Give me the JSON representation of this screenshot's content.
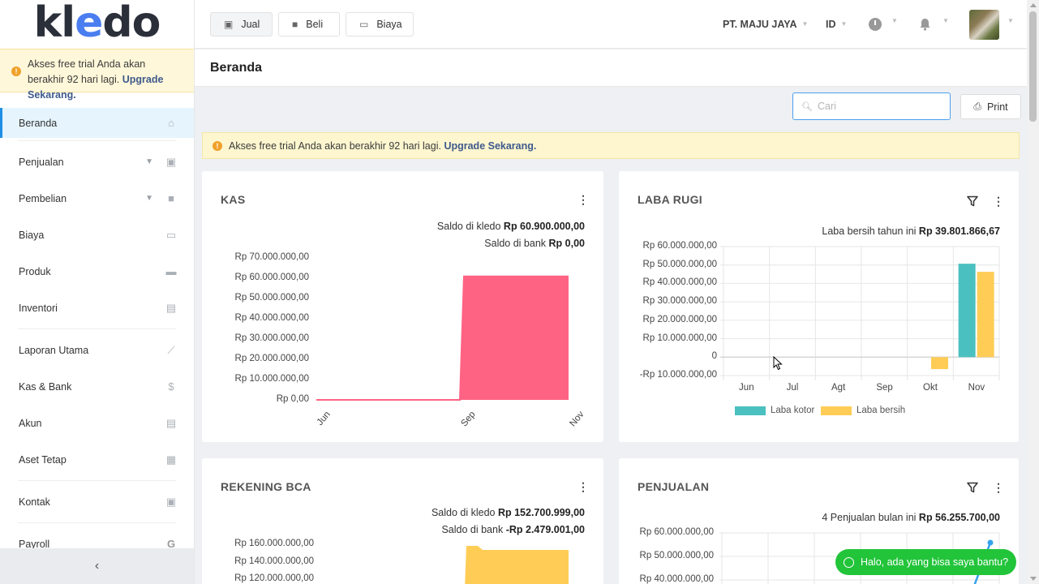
{
  "sidebar": {
    "logo": {
      "pre": "kl",
      "mark": "e",
      "post": "do"
    },
    "trial": {
      "text": "Akses free trial Anda akan berakhir 92 hari lagi.",
      "link": "Upgrade Sekarang."
    },
    "items": [
      {
        "label": "Beranda",
        "icon": "home-icon"
      },
      {
        "label": "Penjualan",
        "icon": "basket-icon"
      },
      {
        "label": "Pembelian",
        "icon": "bag-icon"
      },
      {
        "label": "Biaya",
        "icon": "card-icon"
      },
      {
        "label": "Produk",
        "icon": "box-icon"
      },
      {
        "label": "Inventori",
        "icon": "warehouse-icon"
      },
      {
        "label": "Laporan Utama",
        "icon": "chart-line-icon"
      },
      {
        "label": "Kas & Bank",
        "icon": "dollar-icon"
      },
      {
        "label": "Akun",
        "icon": "list-icon"
      },
      {
        "label": "Aset Tetap",
        "icon": "building-icon"
      },
      {
        "label": "Kontak",
        "icon": "contact-card-icon"
      },
      {
        "label": "Payroll",
        "icon": "payroll-icon"
      }
    ],
    "collapse": "‹"
  },
  "topbar": {
    "jual": "Jual",
    "beli": "Beli",
    "biaya": "Biaya",
    "company": "PT. MAJU JAYA",
    "lang": "ID"
  },
  "page": {
    "title": "Beranda"
  },
  "search": {
    "placeholder": "Cari"
  },
  "print_label": "Print",
  "alert": {
    "text": "Akses free trial Anda akan berakhir 92 hari lagi.",
    "link": "Upgrade Sekarang."
  },
  "cards": {
    "kas": {
      "title": "KAS",
      "stat1_label": "Saldo di kledo",
      "stat1_value": "Rp 60.900.000,00",
      "stat2_label": "Saldo di bank",
      "stat2_value": "Rp 0,00"
    },
    "laba": {
      "title": "LABA RUGI",
      "stat_label": "Laba bersih tahun ini",
      "stat_value": "Rp 39.801.866,67"
    },
    "bca": {
      "title": "REKENING BCA",
      "stat1_label": "Saldo di kledo",
      "stat1_value": "Rp 152.700.999,00",
      "stat2_label": "Saldo di bank",
      "stat2_value": "-Rp 2.479.001,00"
    },
    "penjualan": {
      "title": "PENJUALAN",
      "stat_label": "4 Penjualan bulan ini",
      "stat_value": "Rp 56.255.700,00"
    }
  },
  "chat": "Halo, ada yang bisa saya bantu?",
  "chart_data": [
    {
      "type": "area",
      "title": "KAS",
      "x": [
        "Jun",
        "Sep",
        "Nov"
      ],
      "y_ticks": [
        "Rp 70.000.000,00",
        "Rp 60.000.000,00",
        "Rp 50.000.000,00",
        "Rp 40.000.000,00",
        "Rp 30.000.000,00",
        "Rp 20.000.000,00",
        "Rp 10.000.000,00",
        "Rp 0,00"
      ],
      "ylim": [
        0,
        70000000
      ],
      "series": [
        {
          "values": [
            0,
            0,
            60900000
          ],
          "color": "#ff6384"
        }
      ]
    },
    {
      "type": "bar",
      "title": "LABA RUGI",
      "categories": [
        "Jun",
        "Jul",
        "Agt",
        "Sep",
        "Okt",
        "Nov"
      ],
      "y_ticks": [
        "Rp 60.000.000,00",
        "Rp 50.000.000,00",
        "Rp 40.000.000,00",
        "Rp 30.000.000,00",
        "Rp 20.000.000,00",
        "Rp 10.000.000,00",
        "0",
        "-Rp 10.000.000,00"
      ],
      "ylim": [
        -10000000,
        60000000
      ],
      "series": [
        {
          "name": "Laba kotor",
          "color": "#4bc0c0",
          "values": [
            0,
            0,
            0,
            0,
            0,
            50700000
          ]
        },
        {
          "name": "Laba bersih",
          "color": "#ffcd56",
          "values": [
            0,
            0,
            0,
            0,
            -6500000,
            46300000
          ]
        }
      ]
    },
    {
      "type": "area",
      "title": "REKENING BCA",
      "y_ticks": [
        "Rp 160.000.000,00",
        "Rp 140.000.000,00",
        "Rp 120.000.000,00"
      ],
      "series": [
        {
          "values": [
            152700999
          ],
          "color": "#ffcd56"
        }
      ]
    },
    {
      "type": "line",
      "title": "PENJUALAN",
      "y_ticks": [
        "Rp 60.000.000,00",
        "Rp 50.000.000,00",
        "Rp 40.000.000,00"
      ],
      "series": [
        {
          "values": [
            56255700
          ],
          "color": "#36a2eb"
        }
      ]
    }
  ]
}
